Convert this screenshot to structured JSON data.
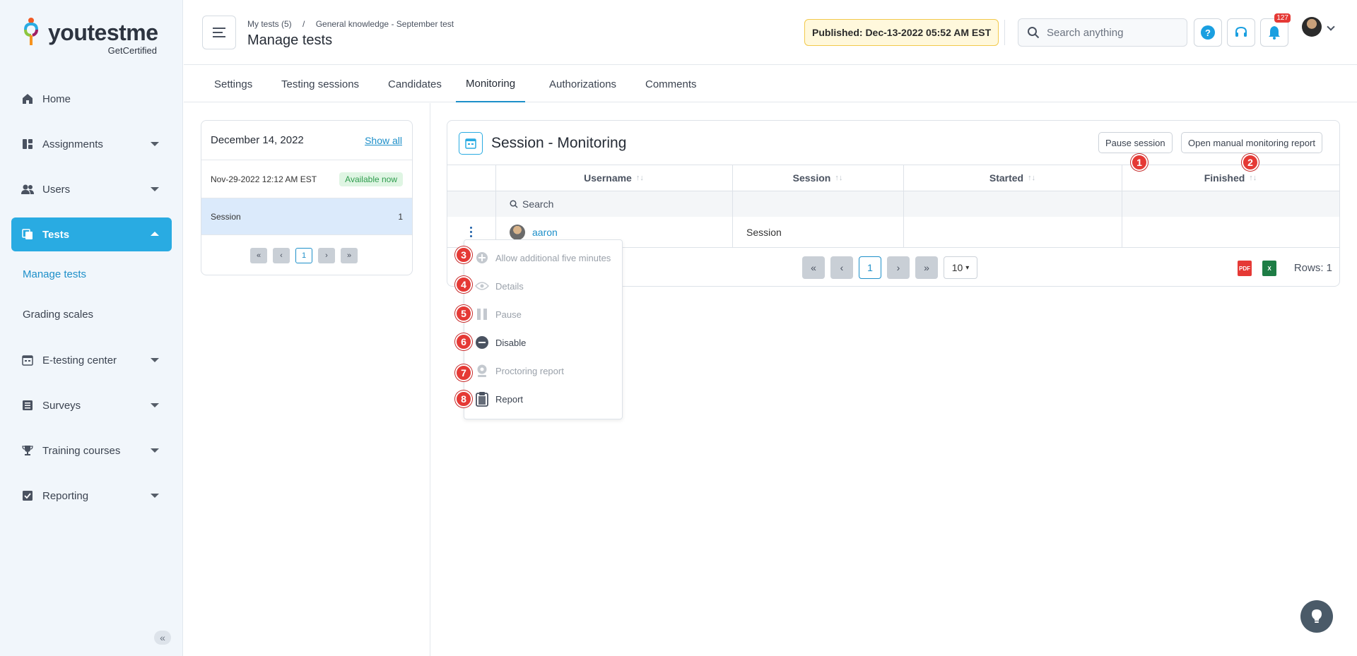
{
  "brand": {
    "name": "youtestme",
    "tagline": "GetCertified"
  },
  "sidebar": {
    "items": [
      {
        "label": "Home",
        "icon": "home-icon"
      },
      {
        "label": "Assignments",
        "icon": "assignments-icon"
      },
      {
        "label": "Users",
        "icon": "users-icon"
      },
      {
        "label": "Tests",
        "icon": "tests-icon"
      },
      {
        "label": "E-testing center",
        "icon": "calendar-icon"
      },
      {
        "label": "Surveys",
        "icon": "list-icon"
      },
      {
        "label": "Training courses",
        "icon": "trophy-icon"
      },
      {
        "label": "Reporting",
        "icon": "reporting-icon"
      }
    ],
    "sub_items": [
      "Manage tests",
      "Grading scales"
    ],
    "collapse": "«"
  },
  "header": {
    "breadcrumb": [
      "My tests (5)",
      "/",
      "General knowledge - September test"
    ],
    "title": "Manage tests",
    "published": "Published: Dec-13-2022 05:52 AM EST",
    "search_placeholder": "Search anything",
    "help": "?",
    "notifications": "127"
  },
  "tabs": [
    "Settings",
    "Testing sessions",
    "Candidates",
    "Monitoring",
    "Authorizations",
    "Comments"
  ],
  "session_panel": {
    "date": "December 14, 2022",
    "show_all": "Show all",
    "row1_time": "Nov-29-2022 12:12 AM EST",
    "row1_badge": "Available now",
    "row2_label": "Session",
    "row2_count": "1",
    "page": "1"
  },
  "monitoring": {
    "title": "Session - Monitoring",
    "pause_btn": "Pause session",
    "report_btn": "Open manual monitoring report",
    "columns": [
      "Username",
      "Session",
      "Started",
      "Finished"
    ],
    "sort_glyph": "↑↓",
    "search_placeholder": "Search",
    "row": {
      "username": "aaron",
      "session": "Session"
    },
    "page": "1",
    "rows_per_page": "10",
    "rows_count": "Rows: 1"
  },
  "menu": {
    "items": [
      {
        "label": "Allow additional five minutes",
        "enabled": false
      },
      {
        "label": "Details",
        "enabled": false
      },
      {
        "label": "Pause",
        "enabled": false
      },
      {
        "label": "Disable",
        "enabled": true
      },
      {
        "label": "Proctoring report",
        "enabled": false
      },
      {
        "label": "Report",
        "enabled": true
      }
    ]
  },
  "markers": [
    "1",
    "2",
    "3",
    "4",
    "5",
    "6",
    "7",
    "8"
  ],
  "colors": {
    "accent": "#29abe2",
    "link": "#1d8fc9",
    "marker": "#e53935",
    "published_bg": "#fff8dc"
  }
}
